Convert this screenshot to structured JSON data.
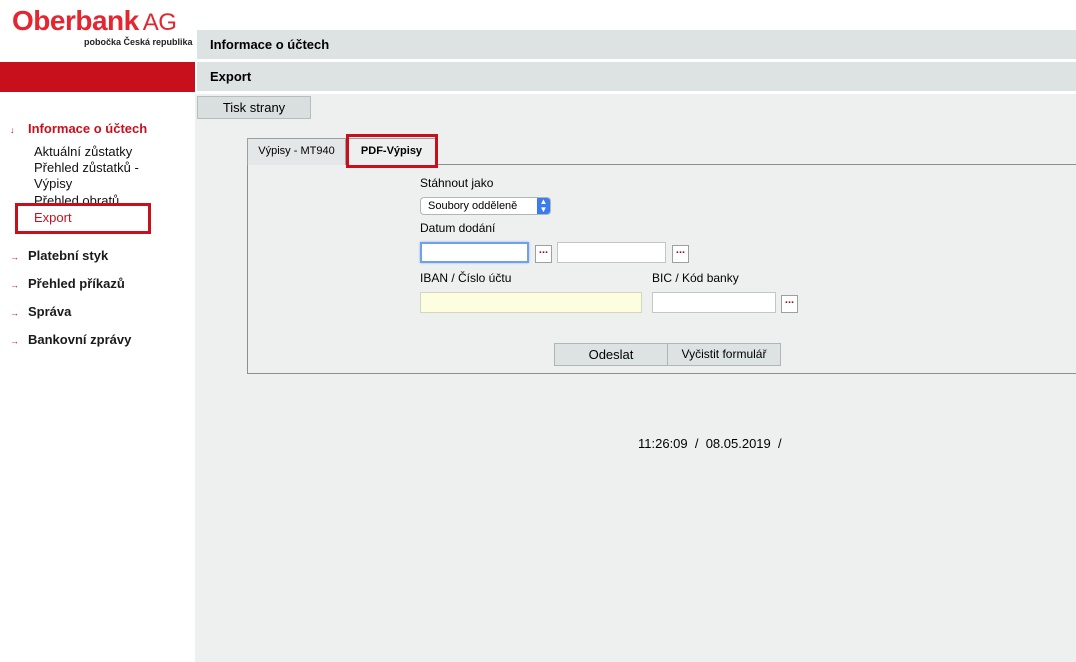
{
  "logo": {
    "name": "Oberbank",
    "suffix": "AG",
    "subtitle": "pobočka Česká republika"
  },
  "header": {
    "section_title": "Informace o účtech",
    "page_title": "Export"
  },
  "toolbar": {
    "print_label": "Tisk strany"
  },
  "sidebar": {
    "items": [
      {
        "label": "Informace o účtech",
        "arrow": "↓",
        "active": true
      },
      {
        "label": "Platební styk",
        "arrow": "→"
      },
      {
        "label": "Přehled příkazů",
        "arrow": "→"
      },
      {
        "label": "Správa",
        "arrow": "→"
      },
      {
        "label": "Bankovní zprávy",
        "arrow": "→"
      }
    ],
    "subitems": [
      {
        "label": "Aktuální zůstatky"
      },
      {
        "label": "Přehled zůstatků - Výpisy"
      },
      {
        "label": "Přehled obratů"
      },
      {
        "label": "Export",
        "active": true
      }
    ]
  },
  "tabs": [
    {
      "label": "Výpisy - MT940"
    },
    {
      "label": "PDF-Výpisy",
      "active": true
    }
  ],
  "form": {
    "download_as_label": "Stáhnout jako",
    "download_as_value": "Soubory odděleně",
    "delivery_date_label": "Datum dodání",
    "date_from_value": "",
    "date_to_value": "",
    "iban_label": "IBAN / Číslo účtu",
    "iban_value": "",
    "bic_label": "BIC / Kód banky",
    "bic_value": "",
    "picker_label": "...",
    "submit_label": "Odeslat",
    "clear_label": "Vyčistit formulář"
  },
  "footer": {
    "timestamp": "11:26:09  /  08.05.2019  /"
  },
  "colors": {
    "brand_red": "#c8101d",
    "header_grey": "#dde2e2",
    "content_grey": "#eef0f0"
  }
}
